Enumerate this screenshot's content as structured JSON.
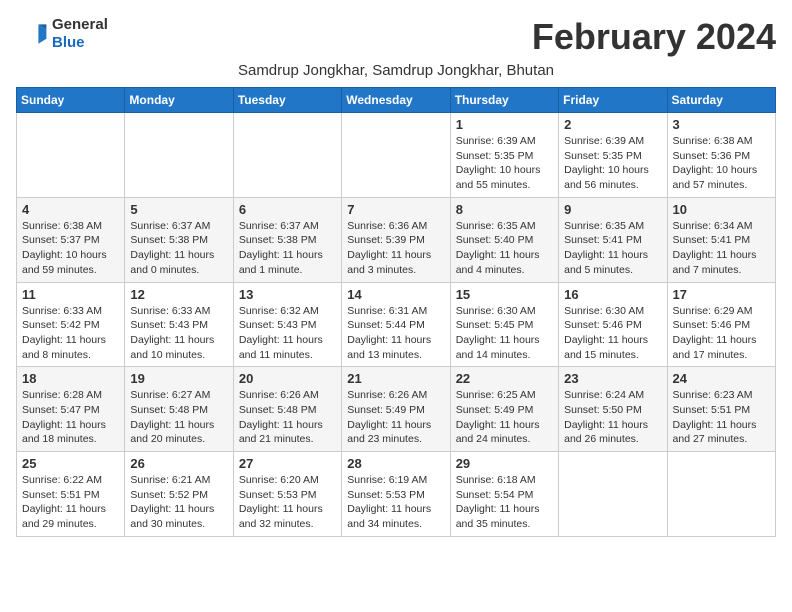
{
  "header": {
    "logo_general": "General",
    "logo_blue": "Blue",
    "month_title": "February 2024",
    "subtitle": "Samdrup Jongkhar, Samdrup Jongkhar, Bhutan"
  },
  "days_of_week": [
    "Sunday",
    "Monday",
    "Tuesday",
    "Wednesday",
    "Thursday",
    "Friday",
    "Saturday"
  ],
  "weeks": [
    [
      {
        "day": "",
        "info": ""
      },
      {
        "day": "",
        "info": ""
      },
      {
        "day": "",
        "info": ""
      },
      {
        "day": "",
        "info": ""
      },
      {
        "day": "1",
        "info": "Sunrise: 6:39 AM\nSunset: 5:35 PM\nDaylight: 10 hours\nand 55 minutes."
      },
      {
        "day": "2",
        "info": "Sunrise: 6:39 AM\nSunset: 5:35 PM\nDaylight: 10 hours\nand 56 minutes."
      },
      {
        "day": "3",
        "info": "Sunrise: 6:38 AM\nSunset: 5:36 PM\nDaylight: 10 hours\nand 57 minutes."
      }
    ],
    [
      {
        "day": "4",
        "info": "Sunrise: 6:38 AM\nSunset: 5:37 PM\nDaylight: 10 hours\nand 59 minutes."
      },
      {
        "day": "5",
        "info": "Sunrise: 6:37 AM\nSunset: 5:38 PM\nDaylight: 11 hours\nand 0 minutes."
      },
      {
        "day": "6",
        "info": "Sunrise: 6:37 AM\nSunset: 5:38 PM\nDaylight: 11 hours\nand 1 minute."
      },
      {
        "day": "7",
        "info": "Sunrise: 6:36 AM\nSunset: 5:39 PM\nDaylight: 11 hours\nand 3 minutes."
      },
      {
        "day": "8",
        "info": "Sunrise: 6:35 AM\nSunset: 5:40 PM\nDaylight: 11 hours\nand 4 minutes."
      },
      {
        "day": "9",
        "info": "Sunrise: 6:35 AM\nSunset: 5:41 PM\nDaylight: 11 hours\nand 5 minutes."
      },
      {
        "day": "10",
        "info": "Sunrise: 6:34 AM\nSunset: 5:41 PM\nDaylight: 11 hours\nand 7 minutes."
      }
    ],
    [
      {
        "day": "11",
        "info": "Sunrise: 6:33 AM\nSunset: 5:42 PM\nDaylight: 11 hours\nand 8 minutes."
      },
      {
        "day": "12",
        "info": "Sunrise: 6:33 AM\nSunset: 5:43 PM\nDaylight: 11 hours\nand 10 minutes."
      },
      {
        "day": "13",
        "info": "Sunrise: 6:32 AM\nSunset: 5:43 PM\nDaylight: 11 hours\nand 11 minutes."
      },
      {
        "day": "14",
        "info": "Sunrise: 6:31 AM\nSunset: 5:44 PM\nDaylight: 11 hours\nand 13 minutes."
      },
      {
        "day": "15",
        "info": "Sunrise: 6:30 AM\nSunset: 5:45 PM\nDaylight: 11 hours\nand 14 minutes."
      },
      {
        "day": "16",
        "info": "Sunrise: 6:30 AM\nSunset: 5:46 PM\nDaylight: 11 hours\nand 15 minutes."
      },
      {
        "day": "17",
        "info": "Sunrise: 6:29 AM\nSunset: 5:46 PM\nDaylight: 11 hours\nand 17 minutes."
      }
    ],
    [
      {
        "day": "18",
        "info": "Sunrise: 6:28 AM\nSunset: 5:47 PM\nDaylight: 11 hours\nand 18 minutes."
      },
      {
        "day": "19",
        "info": "Sunrise: 6:27 AM\nSunset: 5:48 PM\nDaylight: 11 hours\nand 20 minutes."
      },
      {
        "day": "20",
        "info": "Sunrise: 6:26 AM\nSunset: 5:48 PM\nDaylight: 11 hours\nand 21 minutes."
      },
      {
        "day": "21",
        "info": "Sunrise: 6:26 AM\nSunset: 5:49 PM\nDaylight: 11 hours\nand 23 minutes."
      },
      {
        "day": "22",
        "info": "Sunrise: 6:25 AM\nSunset: 5:49 PM\nDaylight: 11 hours\nand 24 minutes."
      },
      {
        "day": "23",
        "info": "Sunrise: 6:24 AM\nSunset: 5:50 PM\nDaylight: 11 hours\nand 26 minutes."
      },
      {
        "day": "24",
        "info": "Sunrise: 6:23 AM\nSunset: 5:51 PM\nDaylight: 11 hours\nand 27 minutes."
      }
    ],
    [
      {
        "day": "25",
        "info": "Sunrise: 6:22 AM\nSunset: 5:51 PM\nDaylight: 11 hours\nand 29 minutes."
      },
      {
        "day": "26",
        "info": "Sunrise: 6:21 AM\nSunset: 5:52 PM\nDaylight: 11 hours\nand 30 minutes."
      },
      {
        "day": "27",
        "info": "Sunrise: 6:20 AM\nSunset: 5:53 PM\nDaylight: 11 hours\nand 32 minutes."
      },
      {
        "day": "28",
        "info": "Sunrise: 6:19 AM\nSunset: 5:53 PM\nDaylight: 11 hours\nand 34 minutes."
      },
      {
        "day": "29",
        "info": "Sunrise: 6:18 AM\nSunset: 5:54 PM\nDaylight: 11 hours\nand 35 minutes."
      },
      {
        "day": "",
        "info": ""
      },
      {
        "day": "",
        "info": ""
      }
    ]
  ]
}
